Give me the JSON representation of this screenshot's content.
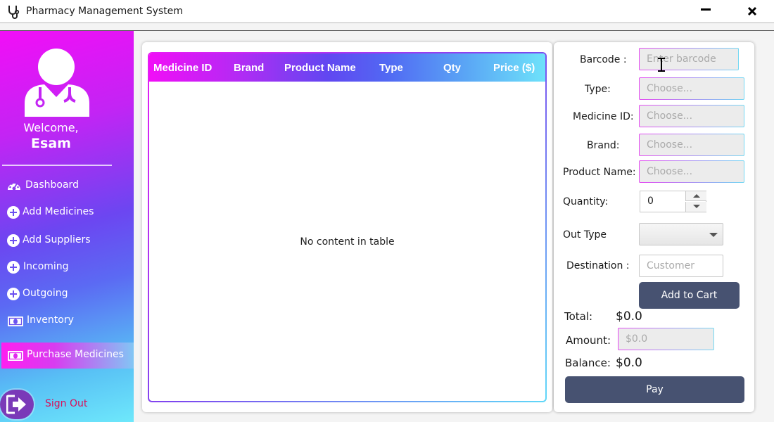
{
  "window": {
    "title": "Pharmacy Management System"
  },
  "sidebar": {
    "welcome": "Welcome,",
    "username": "Esam",
    "items": [
      {
        "label": "Dashboard",
        "icon": "dashboard-icon"
      },
      {
        "label": "Add Medicines",
        "icon": "plus-circle-icon"
      },
      {
        "label": "Add Suppliers",
        "icon": "plus-circle-icon"
      },
      {
        "label": "Incoming",
        "icon": "plus-circle-icon"
      },
      {
        "label": "Outgoing",
        "icon": "plus-circle-icon"
      },
      {
        "label": "Inventory",
        "icon": "money-icon"
      },
      {
        "label": "Purchase Medicines",
        "icon": "money-icon",
        "active": true
      }
    ],
    "sign_out": "Sign Out"
  },
  "table": {
    "columns": [
      "Medicine ID",
      "Brand",
      "Product Name",
      "Type",
      "Qty",
      "Price ($)"
    ],
    "rows": [],
    "empty_message": "No content in table"
  },
  "form": {
    "barcode_label": "Barcode :",
    "barcode_placeholder": "Enter barcode",
    "type_label": "Type:",
    "type_placeholder": "Choose...",
    "medicine_id_label": "Medicine ID:",
    "medicine_id_placeholder": "Choose...",
    "brand_label": "Brand:",
    "brand_placeholder": "Choose...",
    "product_name_label": "Product Name:",
    "product_name_placeholder": "Choose...",
    "quantity_label": "Quantity:",
    "quantity_value": "0",
    "out_type_label": "Out Type",
    "out_type_value": "",
    "destination_label": "Destination :",
    "destination_placeholder": "Customer",
    "add_to_cart": "Add to Cart",
    "total_label": "Total:",
    "total_value": "$0.0",
    "amount_label": "Amount:",
    "amount_placeholder": "$0.0",
    "balance_label": "Balance:",
    "balance_value": "$0.0",
    "pay": "Pay"
  },
  "colors": {
    "sidebar_gradient": [
      "#f20ef7",
      "#6c46f1",
      "#6ee8fb"
    ],
    "button_dark": "#475271",
    "sign_out_text": "#d8105a"
  }
}
